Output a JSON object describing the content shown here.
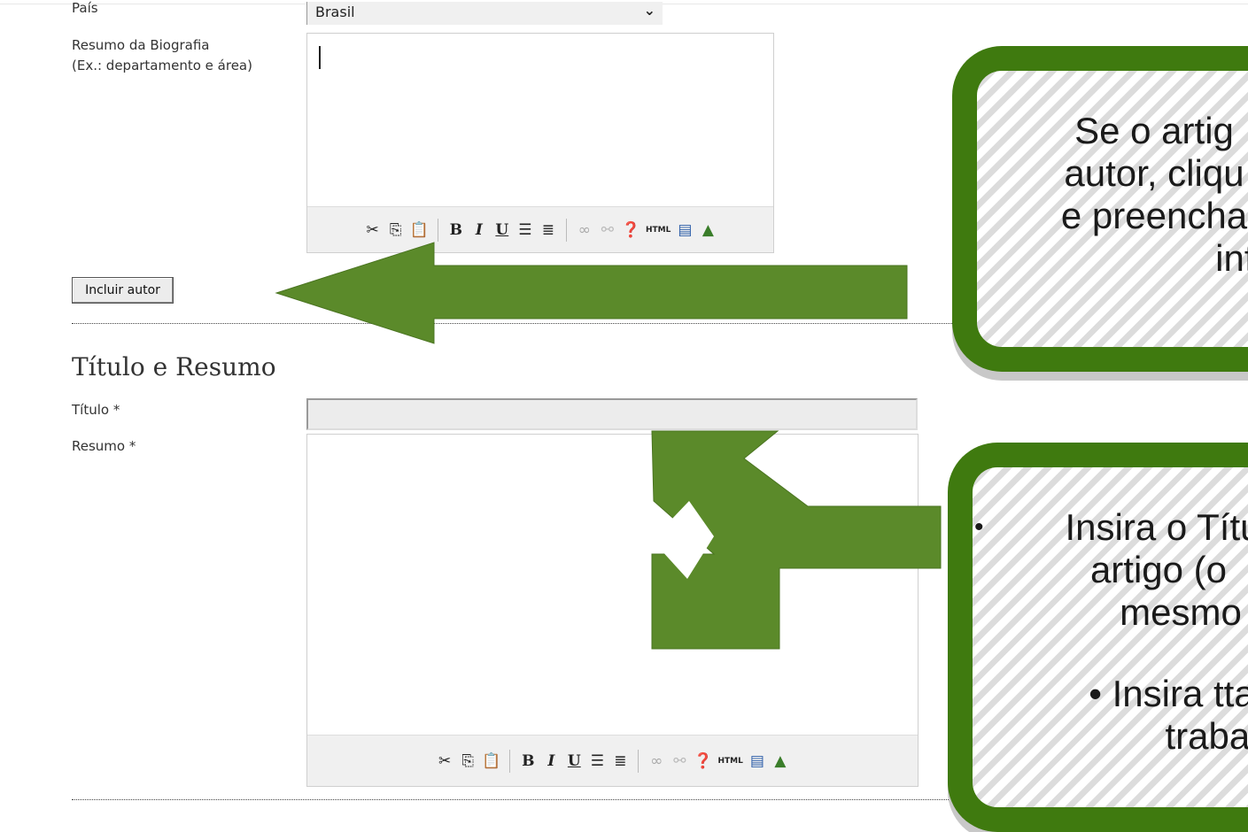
{
  "author": {
    "country_label": "País",
    "country_value": "Brasil",
    "bio_label_line1": "Resumo da Biografia",
    "bio_label_line2": "(Ex.: departamento e área)",
    "include_button": "Incluir autor"
  },
  "title_abstract": {
    "heading": "Título e Resumo",
    "title_label": "Título *",
    "abstract_label": "Resumo *"
  },
  "toolbar": {
    "bold": "B",
    "italic": "I",
    "underline": "U",
    "html": "HTML",
    "icons": [
      "cut-icon",
      "copy-icon",
      "paste-icon",
      "bold-icon",
      "italic-icon",
      "underline-icon",
      "bullet-list-icon",
      "numbered-list-icon",
      "link-icon",
      "unlink-icon",
      "help-icon",
      "html-icon",
      "fullscreen-icon",
      "image-icon"
    ]
  },
  "callout1": {
    "line1": "Se o artig",
    "line2": "autor, cliqu",
    "line3": "e preencha",
    "line4": "infor"
  },
  "callout2": {
    "bullet": "•",
    "line1": "Insira o Títu",
    "line2": "artigo (o",
    "line3": "mesmo",
    "line4": "• Insira tta",
    "line5": "trabal"
  },
  "colors": {
    "callout_border": "#3f7a0f",
    "arrow_fill": "#5b8a2a"
  }
}
